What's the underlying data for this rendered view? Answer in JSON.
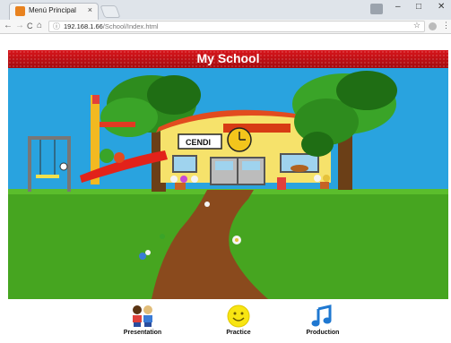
{
  "browser": {
    "tab_title": "Menú Principal",
    "tab_close": "×",
    "url_host": "192.168.1.66",
    "url_path": "/School/Index.html",
    "window_controls": {
      "minimize": "–",
      "maximize": "□",
      "close": "✕"
    },
    "nav": {
      "back": "←",
      "forward": "→",
      "reload": "C",
      "home": "⌂"
    },
    "info_icon": "ⓘ",
    "star": "☆",
    "menu": "⋮"
  },
  "page": {
    "title": "My School",
    "school_sign": "CENDI",
    "colors": {
      "banner": "#c8101a",
      "sky": "#29a3df",
      "grass": "#46a520",
      "path": "#8a4a1d"
    }
  },
  "bottom_nav": {
    "items": [
      {
        "label": "Presentation",
        "icon": "kids-icon"
      },
      {
        "label": "Practice",
        "icon": "smiley-icon"
      },
      {
        "label": "Production",
        "icon": "music-note-icon"
      }
    ]
  }
}
